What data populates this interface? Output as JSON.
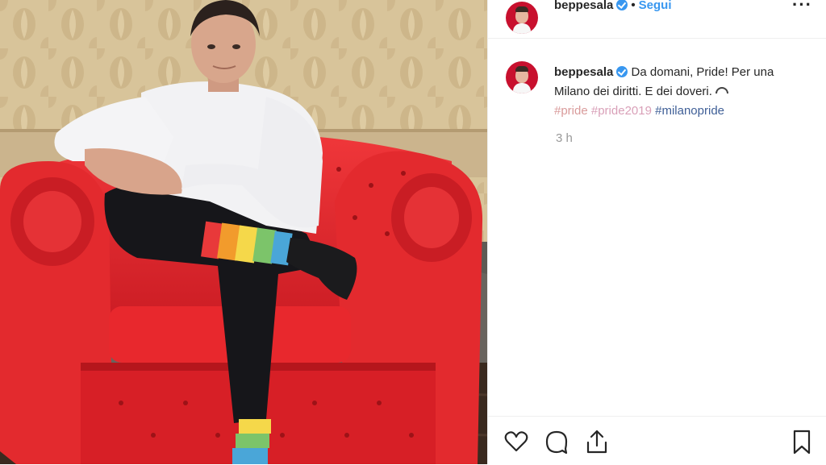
{
  "post": {
    "username": "beppesala",
    "separator": "•",
    "follow_label": "Segui",
    "more_icon": "more-options-icon",
    "caption": {
      "username": "beppesala",
      "text": "Da domani, Pride! Per una Milano dei diritti. E dei doveri.",
      "emoji_icon": "rainbow-icon",
      "hashtags": [
        "#pride",
        "#pride2019",
        "#milanopride"
      ]
    },
    "timestamp": "3 h",
    "actions": {
      "like_icon": "heart-icon",
      "comment_icon": "comment-icon",
      "share_icon": "share-icon",
      "save_icon": "bookmark-icon"
    },
    "verified_color": "#3897f0",
    "link_color": "#3897f0",
    "avatar_color": "#c8102e",
    "armchair_color": "#e3252c"
  }
}
